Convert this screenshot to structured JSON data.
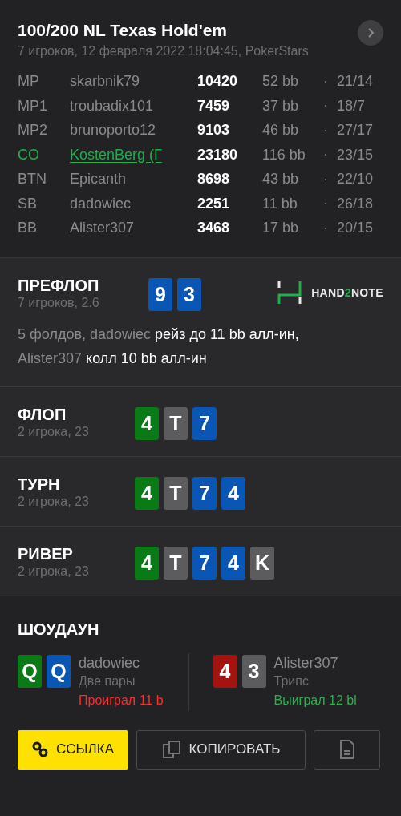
{
  "header": {
    "title": "100/200 NL Texas Hold'em",
    "subtitle": "7 игроков, 12 февраля 2022 18:04:45, PokerStars"
  },
  "players": [
    {
      "position": "MP",
      "name": "skarbnik79",
      "stack": "10420",
      "bb": "52 bb",
      "stats": "21/14",
      "hero": false
    },
    {
      "position": "MP1",
      "name": "troubadix101",
      "stack": "7459",
      "bb": "37 bb",
      "stats": "18/7",
      "hero": false
    },
    {
      "position": "MP2",
      "name": "brunoporto12",
      "stack": "9103",
      "bb": "46 bb",
      "stats": "27/17",
      "hero": false
    },
    {
      "position": "CO",
      "name": "KostenBerg (Г",
      "stack": "23180",
      "bb": "116 bb",
      "stats": "23/15",
      "hero": true
    },
    {
      "position": "BTN",
      "name": "Epicanth",
      "stack": "8698",
      "bb": "43 bb",
      "stats": "22/10",
      "hero": false
    },
    {
      "position": "SB",
      "name": "dadowiec",
      "stack": "2251",
      "bb": "11 bb",
      "stats": "26/18",
      "hero": false
    },
    {
      "position": "BB",
      "name": "Alister307",
      "stack": "3468",
      "bb": "17 bb",
      "stats": "20/15",
      "hero": false
    }
  ],
  "streets": [
    {
      "name": "ПРЕФЛОП",
      "info": "7 игроков, 2.6",
      "logo": {
        "left": "HAND",
        "accent": "2",
        "right": "NOTE"
      },
      "cards": [
        {
          "rank": "9",
          "color": "#0a56b4"
        },
        {
          "rank": "3",
          "color": "#0a56b4"
        }
      ],
      "action": [
        {
          "text": "5 фолдов, dadowiec",
          "kind": "player"
        },
        {
          "text": "рейз до 11 bb алл-ин,",
          "kind": "move"
        },
        {
          "text": "Alister307",
          "kind": "player"
        },
        {
          "text": "колл 10 bb алл-ин",
          "kind": "move"
        }
      ]
    },
    {
      "name": "ФЛОП",
      "info": "2 игрока, 23",
      "cards": [
        {
          "rank": "4",
          "color": "#0a7a17"
        },
        {
          "rank": "T",
          "color": "#5c5c5e"
        },
        {
          "rank": "7",
          "color": "#0a56b4"
        }
      ]
    },
    {
      "name": "ТУРН",
      "info": "2 игрока, 23",
      "cards": [
        {
          "rank": "4",
          "color": "#0a7a17"
        },
        {
          "rank": "T",
          "color": "#5c5c5e"
        },
        {
          "rank": "7",
          "color": "#0a56b4"
        },
        {
          "rank": "4",
          "color": "#0a56b4"
        }
      ]
    },
    {
      "name": "РИВЕР",
      "info": "2 игрока, 23",
      "cards": [
        {
          "rank": "4",
          "color": "#0a7a17"
        },
        {
          "rank": "T",
          "color": "#5c5c5e"
        },
        {
          "rank": "7",
          "color": "#0a56b4"
        },
        {
          "rank": "4",
          "color": "#0a56b4"
        },
        {
          "rank": "K",
          "color": "#5c5c5e"
        }
      ]
    }
  ],
  "showdown": {
    "title": "ШОУДАУН",
    "hands": [
      {
        "cards": [
          {
            "rank": "Q",
            "color": "#0a7a17"
          },
          {
            "rank": "Q",
            "color": "#0a56b4"
          }
        ],
        "name": "dadowiec",
        "combo": "Две пары",
        "result": "Проиграл 11 b",
        "kind": "lost"
      },
      {
        "cards": [
          {
            "rank": "4",
            "color": "#a3130f"
          },
          {
            "rank": "3",
            "color": "#5c5c5e"
          }
        ],
        "name": "Alister307",
        "combo": "Трипс",
        "result": "Выиграл 12 bl",
        "kind": "won"
      }
    ]
  },
  "buttons": [
    {
      "kind": "link",
      "label": "ССЫЛКА"
    },
    {
      "kind": "copy",
      "label": "КОПИРОВАТЬ"
    },
    {
      "kind": "file"
    }
  ]
}
